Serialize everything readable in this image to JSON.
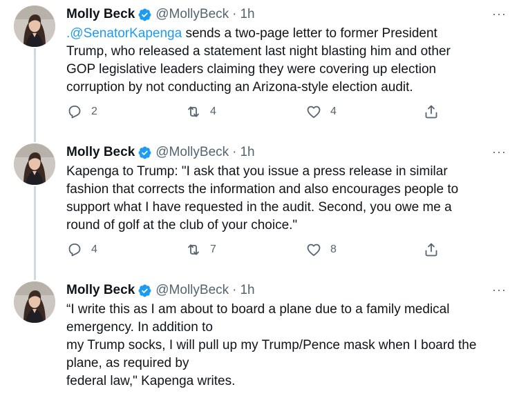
{
  "tweets": [
    {
      "author": "Molly Beck",
      "handle": "@MollyBeck",
      "separator": "·",
      "time": "1h",
      "more": "···",
      "mention": ".@SenatorKapenga",
      "lines": [
        " sends a two-page letter to former President",
        "Trump, who released a statement last night blasting him and other",
        "GOP legislative leaders claiming they were covering up election",
        "corruption by not conducting an Arizona-style election audit."
      ],
      "replies": "2",
      "retweets": "4",
      "likes": "4"
    },
    {
      "author": "Molly Beck",
      "handle": "@MollyBeck",
      "separator": "·",
      "time": "1h",
      "more": "···",
      "lines": [
        "Kapenga to Trump: \"I ask that you issue a press release in similar",
        "fashion that corrects the information and also encourages people to",
        "support what I have requested in the audit. Second, you owe me a",
        "round of golf at the club of your choice.\""
      ],
      "replies": "4",
      "retweets": "7",
      "likes": "8"
    },
    {
      "author": "Molly Beck",
      "handle": "@MollyBeck",
      "separator": "·",
      "time": "1h",
      "more": "···",
      "lines": [
        "“I write this as I am about to board a plane due to a family medical",
        "emergency. In addition to",
        "my Trump socks, I will pull up my Trump/Pence mask when I board the",
        "plane, as required by",
        "federal law,\" Kapenga writes."
      ]
    }
  ],
  "colors": {
    "accent": "#1d9bf0",
    "secondary_text": "#536471",
    "thread_line": "#cfd9de"
  },
  "icons": [
    "verified-badge-icon",
    "more-icon",
    "reply-icon",
    "retweet-icon",
    "like-icon",
    "share-icon"
  ]
}
